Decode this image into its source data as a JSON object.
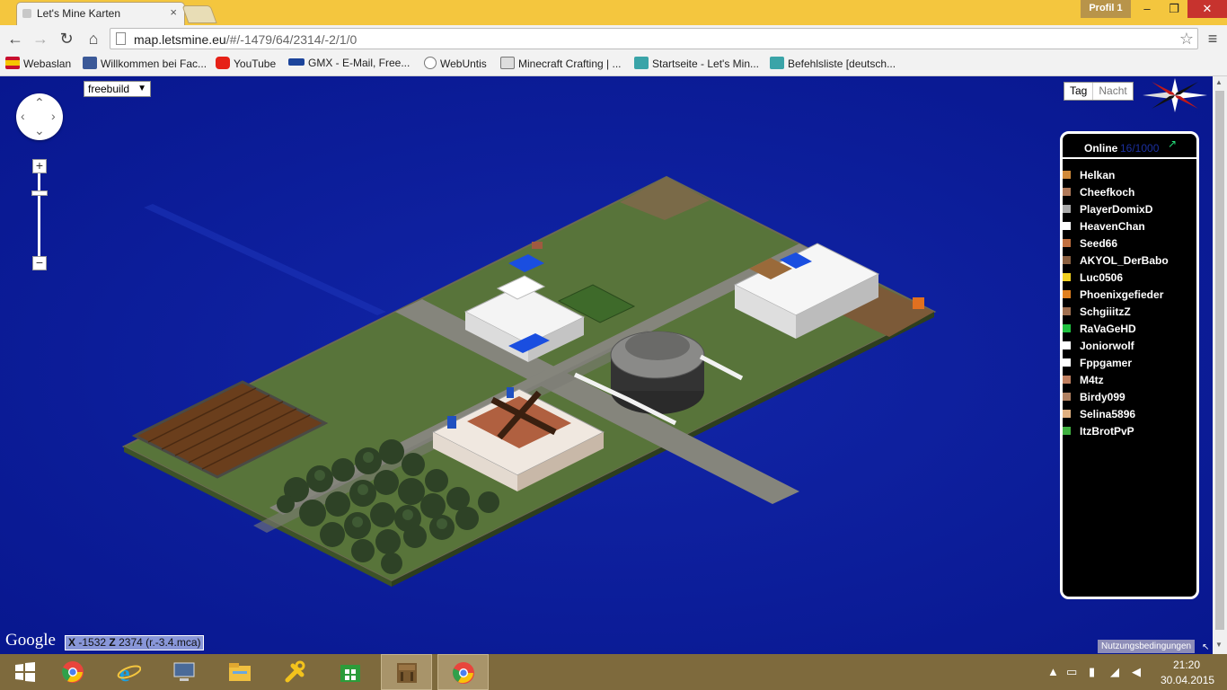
{
  "window": {
    "tab_title": "Let's Mine Karten",
    "tab_close": "×",
    "profile": "Profil 1",
    "min": "–",
    "max": "❐",
    "close": "✕"
  },
  "toolbar": {
    "back": "←",
    "forward": "→",
    "reload": "↻",
    "home": "⌂",
    "url_host": "map.letsmine.eu",
    "url_path": "/#/-1479/64/2314/-2/1/0",
    "star": "☆",
    "menu": "≡"
  },
  "bookmarks": [
    {
      "label": "Webaslan",
      "icon": "spain-flag-icon",
      "color": "#c8102e"
    },
    {
      "label": "Willkommen bei Fac...",
      "icon": "facebook-icon",
      "color": "#3b5998"
    },
    {
      "label": "YouTube",
      "icon": "youtube-icon",
      "color": "#e62117"
    },
    {
      "label": "GMX - E-Mail, Free...",
      "icon": "gmx-icon",
      "color": "#1c449b"
    },
    {
      "label": "WebUntis",
      "icon": "clock-icon",
      "color": "#999999"
    },
    {
      "label": "Minecraft Crafting | ...",
      "icon": "page-icon",
      "color": "#777777"
    },
    {
      "label": "Startseite - Let's Min...",
      "icon": "diamond-block-icon",
      "color": "#3aa4a8"
    },
    {
      "label": "Befehlsliste [deutsch...",
      "icon": "diamond-block-icon",
      "color": "#3aa4a8"
    }
  ],
  "map": {
    "world_select": "freebuild",
    "world_caret": "▼",
    "zoom_in": "+",
    "zoom_out": "−",
    "day_label": "Tag",
    "night_label": "Nacht",
    "panel_title": "Online",
    "panel_count": "16/1000",
    "panel_link": "↗",
    "players": [
      {
        "name": "Helkan",
        "skin": "#d08a3a"
      },
      {
        "name": "Cheefkoch",
        "skin": "#b07a5a"
      },
      {
        "name": "PlayerDomixD",
        "skin": "#a9a9a9"
      },
      {
        "name": "HeavenChan",
        "skin": "#ffffff"
      },
      {
        "name": "Seed66",
        "skin": "#c07040"
      },
      {
        "name": "AKYOL_DerBabo",
        "skin": "#8a6040"
      },
      {
        "name": "Luc0506",
        "skin": "#f0d020"
      },
      {
        "name": "Phoenixgefieder",
        "skin": "#e08020"
      },
      {
        "name": "SchgiiitzZ",
        "skin": "#a07050"
      },
      {
        "name": "RaVaGeHD",
        "skin": "#20c040"
      },
      {
        "name": "Joniorwolf",
        "skin": "#ffffff"
      },
      {
        "name": "Fppgamer",
        "skin": "#ffffff"
      },
      {
        "name": "M4tz",
        "skin": "#c08060"
      },
      {
        "name": "Birdy099",
        "skin": "#b08060"
      },
      {
        "name": "Selina5896",
        "skin": "#e0b080"
      },
      {
        "name": "ItzBrotPvP",
        "skin": "#40b040"
      }
    ],
    "google_label": "Google",
    "coords_x_label": "X",
    "coords_x": "-1532",
    "coords_z_label": "Z",
    "coords_z": "2374",
    "coords_region": "(r.-3.4.mca)",
    "terms": "Nutzungsbedingungen",
    "resize": "↖"
  },
  "taskbar": {
    "items": [
      {
        "name": "windows-start-icon",
        "color": "#ffffff",
        "active": false
      },
      {
        "name": "chrome-icon",
        "color": "#e8453c",
        "active": false
      },
      {
        "name": "internet-explorer-icon",
        "color": "#1ba1e2",
        "active": false
      },
      {
        "name": "computer-icon",
        "color": "#5a7aa0",
        "active": false
      },
      {
        "name": "file-explorer-icon",
        "color": "#f0c040",
        "active": false
      },
      {
        "name": "tool-icon",
        "color": "#f3c31c",
        "active": false
      },
      {
        "name": "store-icon",
        "color": "#2c9c3a",
        "active": false
      },
      {
        "name": "minecraft-icon",
        "color": "#7a5a30",
        "active": true
      },
      {
        "name": "chrome-icon",
        "color": "#e8453c",
        "active": true
      }
    ],
    "time": "21:20",
    "date": "30.04.2015"
  },
  "colors": {
    "water": "#0b1b9c",
    "grass": "#58743a",
    "path": "#7a7a72",
    "dirt": "#8a5a32",
    "accent": "#f4c63e"
  }
}
